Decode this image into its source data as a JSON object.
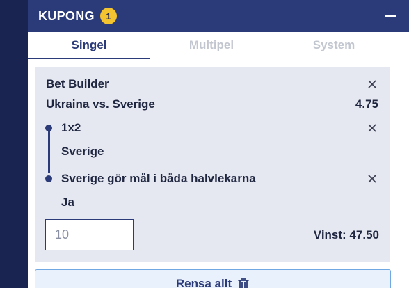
{
  "colors": {
    "header_bg": "#2b3a78",
    "page_bg": "#1a2450",
    "badge": "#f4c430",
    "card_bg": "#e6e8f1",
    "accent_border": "#6fa8e3"
  },
  "header": {
    "title": "KUPONG",
    "count": "1",
    "collapse_icon": "minus-icon"
  },
  "tabs": [
    {
      "label": "Singel",
      "active": true
    },
    {
      "label": "Multipel",
      "active": false
    },
    {
      "label": "System",
      "active": false
    }
  ],
  "bet": {
    "builder_label": "Bet Builder",
    "match": "Ukraina vs. Sverige",
    "odds": "4.75",
    "selections": [
      {
        "market": "1x2",
        "pick": "Sverige"
      },
      {
        "market": "Sverige gör mål i båda halvlekarna",
        "pick": "Ja"
      }
    ],
    "stake_placeholder": "10",
    "win_label": "Vinst:",
    "win_amount": "47.50"
  },
  "footer": {
    "clear_label": "Rensa allt",
    "clear_icon": "trash-icon"
  }
}
